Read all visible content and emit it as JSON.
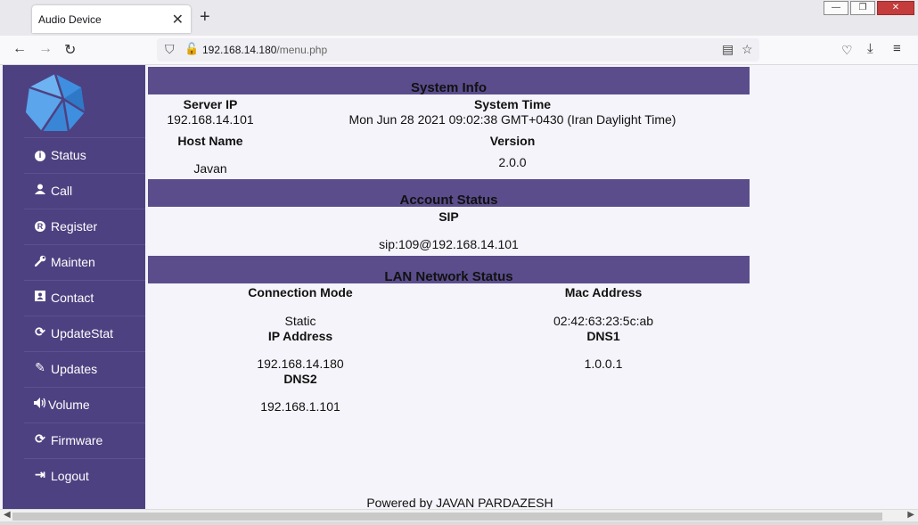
{
  "browser": {
    "tab_title": "Audio Device",
    "tab_close": "✕",
    "new_tab": "+",
    "url_host": "192.168.14.180",
    "url_path": "/menu.php",
    "window_buttons": [
      "—",
      "❐",
      "✕"
    ]
  },
  "sidebar": {
    "items": [
      {
        "label": "Status",
        "icon": "info-icon",
        "glyph": "i"
      },
      {
        "label": "Call",
        "icon": "user-icon",
        "glyph": "👤"
      },
      {
        "label": "Register",
        "icon": "registered-icon",
        "glyph": "R"
      },
      {
        "label": "Mainten",
        "icon": "wrench-icon",
        "glyph": "🔧"
      },
      {
        "label": "Contact",
        "icon": "contact-card-icon",
        "glyph": "▣"
      },
      {
        "label": "UpdateStat",
        "icon": "refresh-icon",
        "glyph": "⟳"
      },
      {
        "label": "Updates",
        "icon": "edit-icon",
        "glyph": "✎"
      },
      {
        "label": "Volume",
        "icon": "volume-icon",
        "glyph": "🔊"
      },
      {
        "label": "Firmware",
        "icon": "refresh-icon",
        "glyph": "⟳"
      },
      {
        "label": "Logout",
        "icon": "sign-out-icon",
        "glyph": "⇥"
      }
    ]
  },
  "system_info": {
    "title": "System Info",
    "server_ip_label": "Server IP",
    "server_ip": "192.168.14.101",
    "system_time_label": "System Time",
    "system_time": "Mon Jun 28 2021 09:02:38 GMT+0430 (Iran Daylight Time)",
    "host_name_label": "Host Name",
    "host_name": "Javan",
    "version_label": "Version",
    "version": "2.0.0"
  },
  "account_status": {
    "title": "Account Status",
    "sip_label": "SIP",
    "sip": "sip:109@192.168.14.101"
  },
  "lan_status": {
    "title": "LAN Network Status",
    "connection_mode_label": "Connection Mode",
    "connection_mode": "Static",
    "mac_address_label": "Mac Address",
    "mac_address": "02:42:63:23:5c:ab",
    "ip_address_label": "IP Address",
    "ip_address": "192.168.14.180",
    "dns1_label": "DNS1",
    "dns1": "1.0.0.1",
    "dns2_label": "DNS2",
    "dns2": "192.168.1.101"
  },
  "footer": "Powered by JAVAN PARDAZESH"
}
